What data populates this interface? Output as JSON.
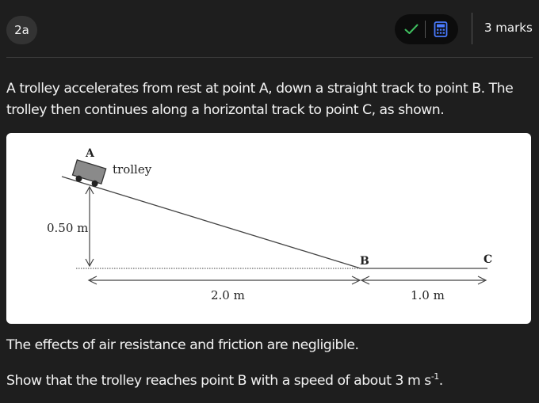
{
  "header": {
    "question_number": "2a",
    "marks": "3 marks",
    "tools": {
      "check_icon": "check-icon",
      "calculator_icon": "calculator-icon",
      "check_color": "#3fbf5f",
      "calculator_color": "#4a7bff"
    }
  },
  "intro": "A trolley accelerates from rest at point A, down a straight track to point B. The trolley then continues along a horizontal track to point C, as shown.",
  "figure": {
    "point_a": "A",
    "point_b": "B",
    "point_c": "C",
    "trolley_label": "trolley",
    "height_label": "0.50 m",
    "slope_length_label": "2.0 m",
    "flat_length_label": "1.0 m"
  },
  "body": {
    "line1": "The effects of air resistance and friction are negligible.",
    "line2_main": "Show that the trolley reaches point B with a speed of about 3 m s",
    "line2_sup": "-1",
    "line2_end": "."
  }
}
